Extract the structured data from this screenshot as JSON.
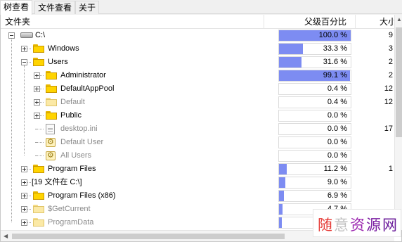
{
  "tabs": [
    {
      "label": "树查看",
      "active": true
    },
    {
      "label": "文件查看",
      "active": false
    },
    {
      "label": "关于",
      "active": false
    }
  ],
  "columns": {
    "folder": "文件夹",
    "parent_percent": "父级百分比",
    "size": "大小"
  },
  "rows": [
    {
      "name": "C:\\",
      "icon": "drive-icon",
      "percent_label": "100.0 %",
      "percent": 100.0,
      "size": "9",
      "expander": "minus",
      "dim": false
    },
    {
      "name": "Windows",
      "icon": "folder-icon",
      "percent_label": "33.3 %",
      "percent": 33.3,
      "size": "3",
      "expander": "plus",
      "dim": false
    },
    {
      "name": "Users",
      "icon": "folder-icon",
      "percent_label": "31.6 %",
      "percent": 31.6,
      "size": "2",
      "expander": "minus",
      "dim": false
    },
    {
      "name": "Administrator",
      "icon": "folder-icon",
      "percent_label": "99.1 %",
      "percent": 99.1,
      "size": "2",
      "expander": "plus",
      "dim": false
    },
    {
      "name": "DefaultAppPool",
      "icon": "folder-icon",
      "percent_label": "0.4 %",
      "percent": 0.4,
      "size": "12",
      "expander": "plus",
      "dim": false
    },
    {
      "name": "Default",
      "icon": "folder-icon-pale",
      "percent_label": "0.4 %",
      "percent": 0.4,
      "size": "12",
      "expander": "plus",
      "dim": true
    },
    {
      "name": "Public",
      "icon": "folder-icon",
      "percent_label": "0.0 %",
      "percent": 0.0,
      "size": "",
      "expander": "plus",
      "dim": false
    },
    {
      "name": "desktop.ini",
      "icon": "file-icon",
      "percent_label": "0.0 %",
      "percent": 0.0,
      "size": "17",
      "expander": "none",
      "dim": true
    },
    {
      "name": "Default User",
      "icon": "shortcut-icon",
      "percent_label": "0.0 %",
      "percent": 0.0,
      "size": "",
      "expander": "none",
      "dim": true
    },
    {
      "name": "All Users",
      "icon": "shortcut-icon",
      "percent_label": "0.0 %",
      "percent": 0.0,
      "size": "",
      "expander": "none",
      "dim": true
    },
    {
      "name": "Program Files",
      "icon": "folder-icon",
      "percent_label": "11.2 %",
      "percent": 11.2,
      "size": "1",
      "expander": "plus",
      "dim": false
    },
    {
      "name": "[19 文件在 C:\\]",
      "icon": "none",
      "percent_label": "9.0 %",
      "percent": 9.0,
      "size": "",
      "expander": "plus",
      "dim": false
    },
    {
      "name": "Program Files (x86)",
      "icon": "folder-icon",
      "percent_label": "6.9 %",
      "percent": 6.9,
      "size": "",
      "expander": "plus",
      "dim": false
    },
    {
      "name": "$GetCurrent",
      "icon": "folder-icon-pale",
      "percent_label": "4.7 %",
      "percent": 4.7,
      "size": "",
      "expander": "plus",
      "dim": true
    },
    {
      "name": "ProgramData",
      "icon": "folder-icon-pale",
      "percent_label": "",
      "percent": 3.5,
      "size": "",
      "expander": "plus",
      "dim": true
    }
  ],
  "watermark": {
    "text": "随意资源网",
    "colors": [
      "#e53935",
      "#c0c0c0",
      "#9c27b0",
      "#7b1fa2",
      "#6a1b9a"
    ]
  },
  "colors": {
    "bar": "#7d8cf2",
    "bar_full": "#7d8cf2"
  }
}
